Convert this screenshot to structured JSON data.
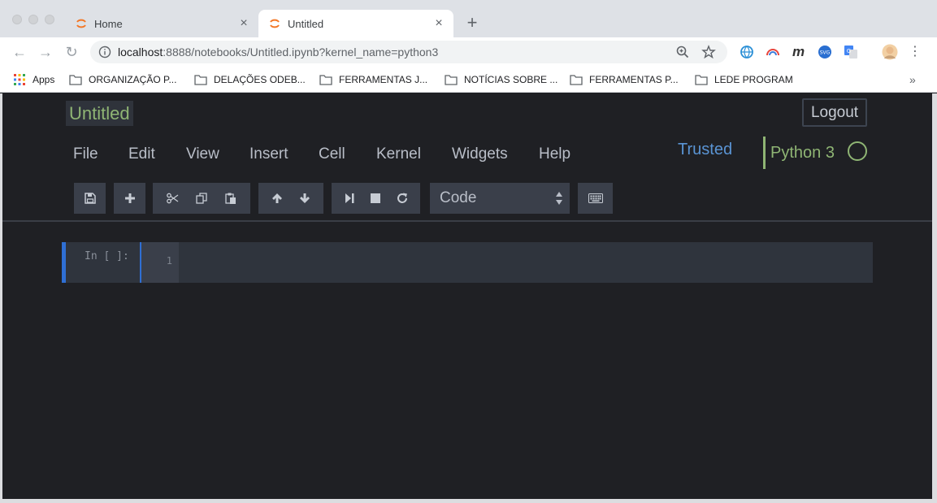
{
  "browser": {
    "tabs": [
      {
        "label": "Home"
      },
      {
        "label": "Untitled"
      }
    ],
    "url_host": "localhost",
    "url_rest": ":8888/notebooks/Untitled.ipynb?kernel_name=python3",
    "bookmarks": [
      "Apps",
      "ORGANIZAÇÃO P...",
      "DELAÇÕES ODEB...",
      "FERRAMENTAS J...",
      "NOTÍCIAS SOBRE ...",
      "FERRAMENTAS P...",
      "LEDE PROGRAM"
    ],
    "overflow": "»"
  },
  "jupyter": {
    "notebook_name": "Untitled",
    "logout_label": "Logout",
    "menu": [
      "File",
      "Edit",
      "View",
      "Insert",
      "Cell",
      "Kernel",
      "Widgets",
      "Help"
    ],
    "trusted_label": "Trusted",
    "kernel_name": "Python 3",
    "cell_type": "Code",
    "cell": {
      "prompt": "In [ ]:",
      "line_number": "1"
    }
  },
  "colors": {
    "background": "#1f2024",
    "accent_green": "#8fb574",
    "accent_blue": "#5a94d4",
    "cell_selected": "#2f6fd4"
  }
}
